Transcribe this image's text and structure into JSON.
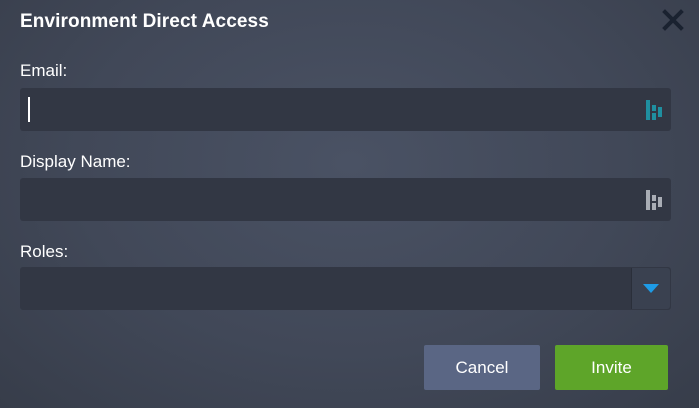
{
  "dialog": {
    "title": "Environment Direct Access",
    "close_icon": "close-icon"
  },
  "fields": {
    "email": {
      "label": "Email:",
      "value": "",
      "placeholder": "",
      "icon": "password-manager-icon",
      "icon_color": "#1f8fa0"
    },
    "display_name": {
      "label": "Display Name:",
      "value": "",
      "placeholder": "",
      "icon": "password-manager-icon",
      "icon_color": "#a9adb5"
    },
    "roles": {
      "label": "Roles:",
      "selected": "",
      "dropdown_icon": "chevron-down-icon",
      "dropdown_color": "#1e9be6"
    }
  },
  "buttons": {
    "cancel_label": "Cancel",
    "invite_label": "Invite"
  },
  "colors": {
    "accent_green": "#5ea529",
    "cancel_blue": "#5a6684",
    "close_icon": "#1a2230"
  }
}
